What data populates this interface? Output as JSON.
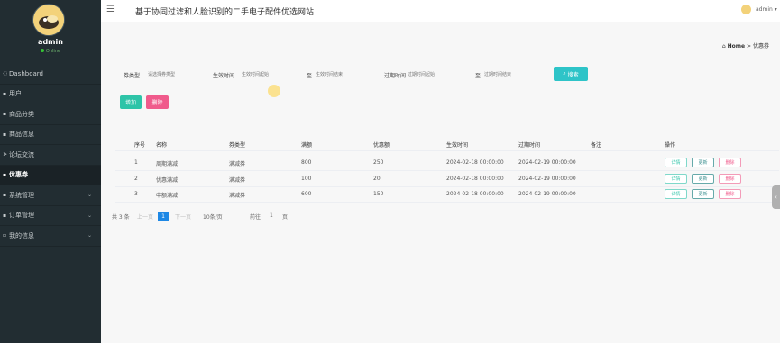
{
  "app": {
    "title": "基于协同过滤和人脸识别的二手电子配件优选网站"
  },
  "user": {
    "name": "admin",
    "status": "Online",
    "top_label": "admin ▾"
  },
  "sidebar": {
    "items": [
      {
        "label": "Dashboard",
        "icon": "◌",
        "chevron": ""
      },
      {
        "label": "用户",
        "icon": "▪",
        "chevron": ""
      },
      {
        "label": "商品分类",
        "icon": "▪",
        "chevron": ""
      },
      {
        "label": "商品信息",
        "icon": "▪",
        "chevron": ""
      },
      {
        "label": "论坛交流",
        "icon": "➤",
        "chevron": ""
      },
      {
        "label": "优惠券",
        "icon": "▪",
        "chevron": ""
      },
      {
        "label": "系统管理",
        "icon": "▪",
        "chevron": "⌄"
      },
      {
        "label": "订单管理",
        "icon": "▪",
        "chevron": "⌄"
      },
      {
        "label": "我的信息",
        "icon": "▫",
        "chevron": "⌄"
      }
    ],
    "active_index": 5
  },
  "breadcrumb": {
    "home": "Home",
    "sep": ">",
    "current": "优惠券"
  },
  "filters": {
    "type_label": "券类型",
    "type_placeholder": "请选择券类型",
    "start_label": "生效时间",
    "start_from_placeholder": "生效时间起始",
    "start_to_placeholder": "生效时间结束",
    "end_label": "过期时间",
    "end_from_placeholder": "过期时间起始",
    "end_to_placeholder": "过期时间结束",
    "separator": "至",
    "search_label": "搜索"
  },
  "actions": {
    "add": "增加",
    "delete": "删除"
  },
  "table": {
    "columns": [
      "序号",
      "名称",
      "券类型",
      "满额",
      "优惠额",
      "生效时间",
      "过期时间",
      "备注",
      "操作"
    ],
    "rows": [
      [
        "1",
        "周期满减",
        "满减券",
        "800",
        "250",
        "2024-02-18 00:00:00",
        "2024-02-19 00:00:00",
        ""
      ],
      [
        "2",
        "优惠满减",
        "满减券",
        "100",
        "20",
        "2024-02-18 00:00:00",
        "2024-02-19 00:00:00",
        ""
      ],
      [
        "3",
        "中额满减",
        "满减券",
        "600",
        "150",
        "2024-02-18 00:00:00",
        "2024-02-19 00:00:00",
        ""
      ]
    ],
    "row_buttons": {
      "detail": "详情",
      "edit": "更新",
      "delete": "删除"
    }
  },
  "pagination": {
    "total": "共 3 条",
    "prev": "上一页",
    "current": "1",
    "next": "下一页",
    "page_size": "10条/页",
    "goto_label": "前往",
    "goto_value": "1",
    "page_unit": "页"
  },
  "colors": {
    "sidebar": "#222d32",
    "accent": "#2ec4c8",
    "danger": "#f05b8c"
  }
}
